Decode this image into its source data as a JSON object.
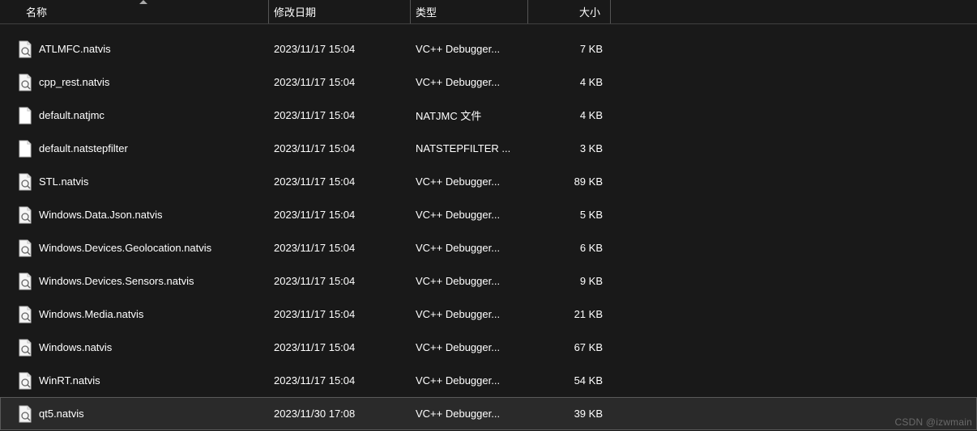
{
  "columns": {
    "name": "名称",
    "date": "修改日期",
    "type": "类型",
    "size": "大小"
  },
  "icons": {
    "natvis": "natvis-file-icon",
    "plain": "plain-file-icon"
  },
  "rows": [
    {
      "name": "ATLMFC.natvis",
      "date": "2023/11/17 15:04",
      "type": "VC++ Debugger...",
      "size": "7 KB",
      "icon": "natvis",
      "selected": false
    },
    {
      "name": "cpp_rest.natvis",
      "date": "2023/11/17 15:04",
      "type": "VC++ Debugger...",
      "size": "4 KB",
      "icon": "natvis",
      "selected": false
    },
    {
      "name": "default.natjmc",
      "date": "2023/11/17 15:04",
      "type": "NATJMC 文件",
      "size": "4 KB",
      "icon": "plain",
      "selected": false
    },
    {
      "name": "default.natstepfilter",
      "date": "2023/11/17 15:04",
      "type": "NATSTEPFILTER ...",
      "size": "3 KB",
      "icon": "plain",
      "selected": false
    },
    {
      "name": "STL.natvis",
      "date": "2023/11/17 15:04",
      "type": "VC++ Debugger...",
      "size": "89 KB",
      "icon": "natvis",
      "selected": false
    },
    {
      "name": "Windows.Data.Json.natvis",
      "date": "2023/11/17 15:04",
      "type": "VC++ Debugger...",
      "size": "5 KB",
      "icon": "natvis",
      "selected": false
    },
    {
      "name": "Windows.Devices.Geolocation.natvis",
      "date": "2023/11/17 15:04",
      "type": "VC++ Debugger...",
      "size": "6 KB",
      "icon": "natvis",
      "selected": false
    },
    {
      "name": "Windows.Devices.Sensors.natvis",
      "date": "2023/11/17 15:04",
      "type": "VC++ Debugger...",
      "size": "9 KB",
      "icon": "natvis",
      "selected": false
    },
    {
      "name": "Windows.Media.natvis",
      "date": "2023/11/17 15:04",
      "type": "VC++ Debugger...",
      "size": "21 KB",
      "icon": "natvis",
      "selected": false
    },
    {
      "name": "Windows.natvis",
      "date": "2023/11/17 15:04",
      "type": "VC++ Debugger...",
      "size": "67 KB",
      "icon": "natvis",
      "selected": false
    },
    {
      "name": "WinRT.natvis",
      "date": "2023/11/17 15:04",
      "type": "VC++ Debugger...",
      "size": "54 KB",
      "icon": "natvis",
      "selected": false
    },
    {
      "name": "qt5.natvis",
      "date": "2023/11/30 17:08",
      "type": "VC++ Debugger...",
      "size": "39 KB",
      "icon": "natvis",
      "selected": true
    }
  ],
  "watermark": "CSDN @izwmain"
}
